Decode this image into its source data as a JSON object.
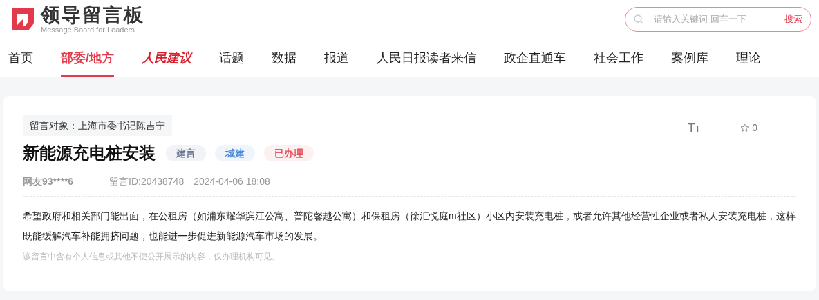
{
  "logo": {
    "title": "领导留言板",
    "subtitle": "Message Board for Leaders"
  },
  "search": {
    "placeholder": "请输入关键词 回车一下",
    "button": "搜索"
  },
  "nav": [
    {
      "label": "首页",
      "selected": false,
      "kind": "text"
    },
    {
      "label": "部委/地方",
      "selected": true,
      "kind": "text"
    },
    {
      "label": "人民建议",
      "selected": false,
      "kind": "brand"
    },
    {
      "label": "话题",
      "selected": false,
      "kind": "text"
    },
    {
      "label": "数据",
      "selected": false,
      "kind": "text"
    },
    {
      "label": "报道",
      "selected": false,
      "kind": "text"
    },
    {
      "label": "人民日报读者来信",
      "selected": false,
      "kind": "text"
    },
    {
      "label": "政企直通车",
      "selected": false,
      "kind": "text"
    },
    {
      "label": "社会工作",
      "selected": false,
      "kind": "text"
    },
    {
      "label": "案例库",
      "selected": false,
      "kind": "text"
    },
    {
      "label": "理论",
      "selected": false,
      "kind": "text"
    }
  ],
  "message": {
    "target": "留言对象：上海市委书记陈吉宁",
    "font_size_button": "Tт",
    "favorites": "0",
    "title": "新能源充电桩安装",
    "tags": [
      {
        "label": "建言",
        "color": "#5b6b86"
      },
      {
        "label": "城建",
        "color": "#3b7dd8"
      },
      {
        "label": "已办理",
        "color": "#e23a4a"
      }
    ],
    "author": "网友93****6",
    "id": "留言ID:20438748",
    "time": "2024-04-06 18:08",
    "body": "希望政府和相关部门能出面，在公租房（如浦东耀华滨江公寓、普陀馨越公寓）和保租房（徐汇悦庭m社区）小区内安装充电桩，或者允许其他经营性企业或者私人安装充电桩，这样既能缓解汽车补能拥挤问题，也能进一步促进新能源汽车市场的发展。",
    "notice": "该留言中含有个人信息或其他不便公开展示的内容，仅办理机构可见。"
  }
}
